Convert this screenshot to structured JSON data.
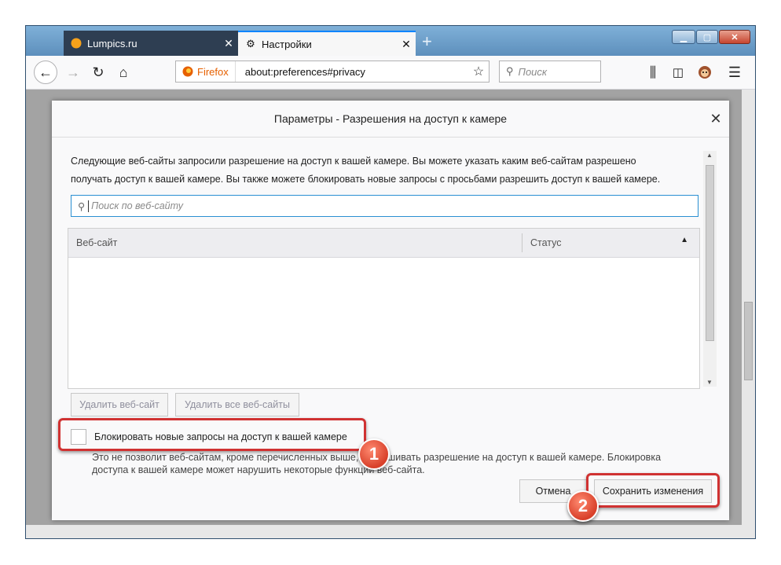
{
  "tabs": [
    {
      "title": "Lumpics.ru",
      "icon": "orange-circle-icon"
    },
    {
      "title": "Настройки",
      "icon": "gear-icon"
    }
  ],
  "toolbar": {
    "url_identity": "Firefox",
    "url": "about:preferences#privacy",
    "search_placeholder": "Поиск"
  },
  "dialog": {
    "title": "Параметры - Разрешения на доступ к камере",
    "description_line1": "Следующие веб-сайты запросили разрешение на доступ к вашей камере. Вы можете указать каким веб-сайтам разрешено",
    "description_line2": "получать доступ к вашей камере. Вы также можете блокировать новые запросы с просьбами разрешить доступ к вашей камере.",
    "filter_placeholder": "Поиск по веб-сайту",
    "columns": [
      "Веб-сайт",
      "Статус"
    ],
    "remove_site": "Удалить веб-сайт",
    "remove_all_sites": "Удалить все веб-сайты",
    "block_checkbox_label": "Блокировать новые запросы на доступ к вашей камере",
    "block_checked": false,
    "block_hint_line1": "Это не позволит веб-сайтам, кроме перечисленных выше, запрашивать разрешение на доступ к вашей камере. Блокировка",
    "block_hint_line2": "доступа к вашей камере может нарушить некоторые функции веб-сайта.",
    "cancel": "Отмена",
    "save": "Сохранить изменения"
  },
  "annotations": {
    "badge1": "1",
    "badge2": "2"
  },
  "colors": {
    "highlight": "#d03232",
    "accent": "#0a84ff",
    "firefox": "#e66000"
  }
}
